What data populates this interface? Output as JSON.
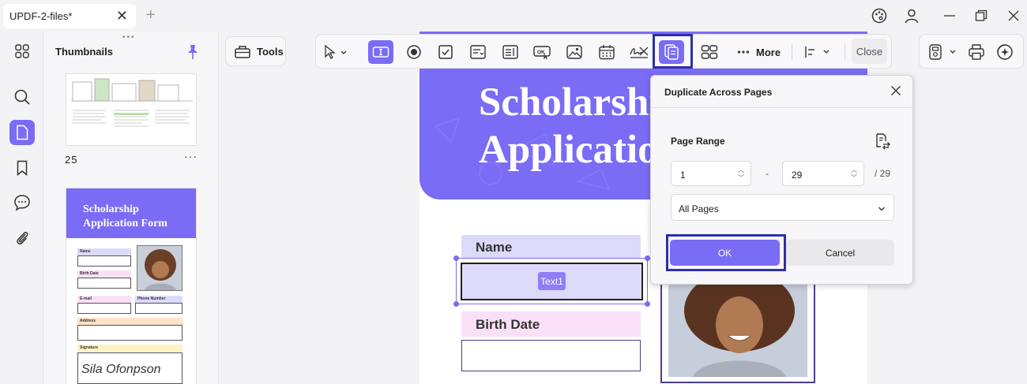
{
  "window": {
    "tab_title": "UPDF-2-files*",
    "colors": {
      "accent": "#7a6cf5",
      "highlight": "#2d2faa"
    }
  },
  "thumbnails": {
    "title": "Thumbnails",
    "page_number": "25",
    "more": "···",
    "cover_title_line1": "Scholarship",
    "cover_title_line2": "Application Form",
    "labels": {
      "name": "Name",
      "birth_date": "Birth Date",
      "email": "E-mail",
      "phone": "Phone Number",
      "address": "Address",
      "signature": "Signature"
    },
    "signature_text": "Sila Ofonpson"
  },
  "toolbar": {
    "tools_label": "Tools",
    "more_label": "More",
    "close_label": "Close"
  },
  "document": {
    "banner_line1": "Scholarshi",
    "banner_line2": "Applicatio",
    "name_label": "Name",
    "field_tag": "Text1",
    "birth_date_label": "Birth Date"
  },
  "dialog": {
    "title": "Duplicate Across Pages",
    "page_range_label": "Page Range",
    "range_from": "1",
    "range_sep": "-",
    "range_to": "29",
    "total": "/ 29",
    "selected_option": "All Pages",
    "ok_label": "OK",
    "cancel_label": "Cancel"
  }
}
